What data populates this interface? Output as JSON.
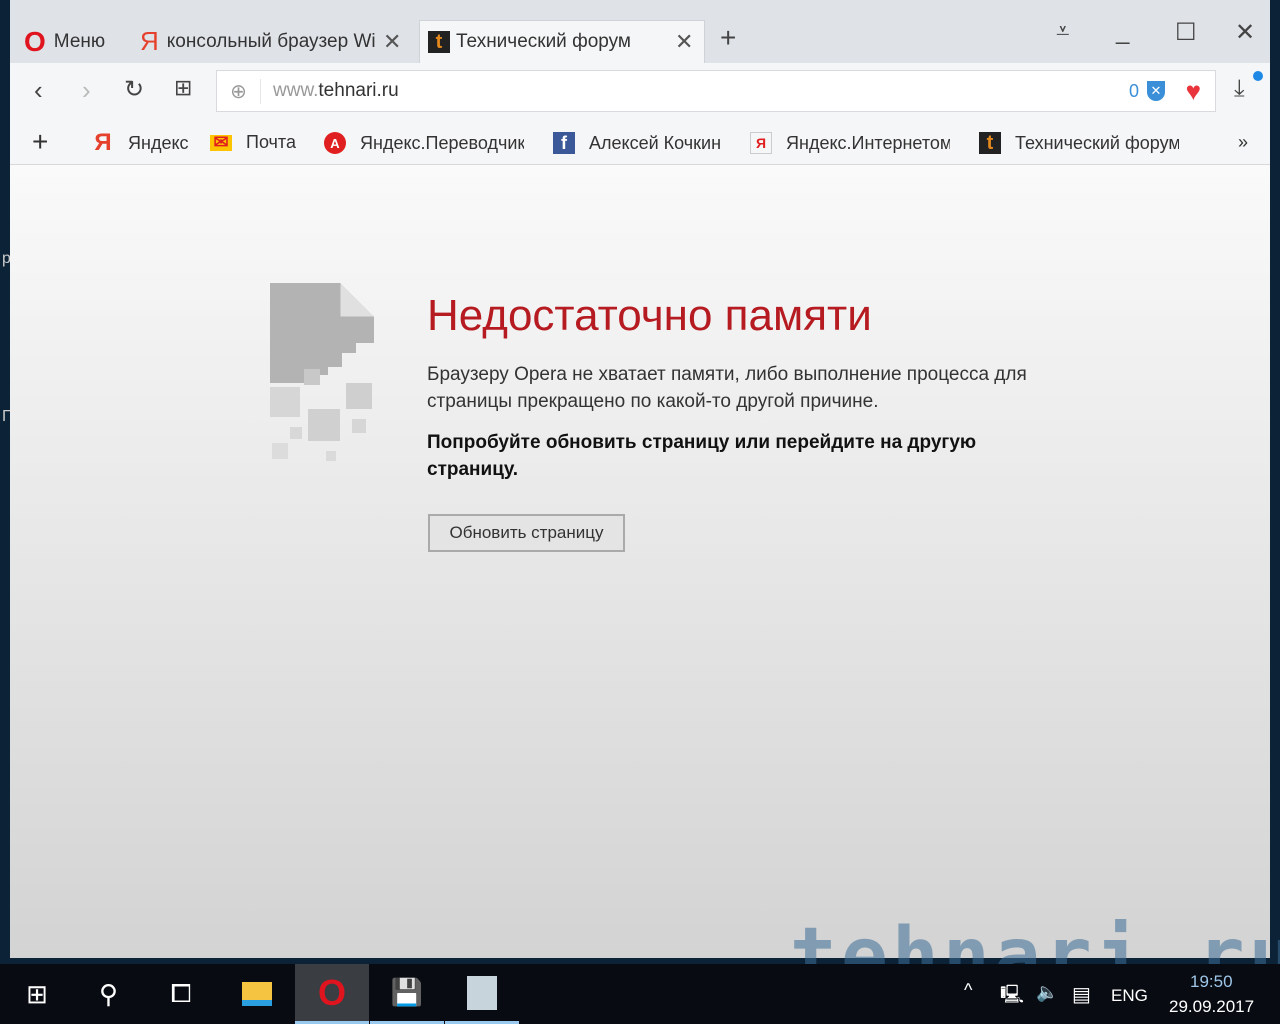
{
  "tabs": [
    {
      "label": "Меню"
    },
    {
      "label": "консольный браузер Win"
    },
    {
      "label": "Технический форум"
    }
  ],
  "address": {
    "prefix": "www.",
    "domain": "tehnari.ru",
    "blocked_count": "0"
  },
  "bookmarks": [
    {
      "label": "Яндекс"
    },
    {
      "label": "Почта"
    },
    {
      "label": "Яндекс.Переводчик"
    },
    {
      "label": "Алексей Кочкин"
    },
    {
      "label": "Яндекс.Интернетом"
    },
    {
      "label": "Технический форум"
    }
  ],
  "error": {
    "title": "Недостаточно памяти",
    "text": "Браузеру Opera не хватает памяти, либо выполнение процесса для страницы прекращено по какой-то другой причине.",
    "hint": "Попробуйте обновить страницу или перейдите на другую страницу.",
    "button": "Обновить страницу"
  },
  "taskbar": {
    "lang": "ENG",
    "time": "19:50",
    "date": "29.09.2017"
  },
  "watermark": "tehnari.ru"
}
